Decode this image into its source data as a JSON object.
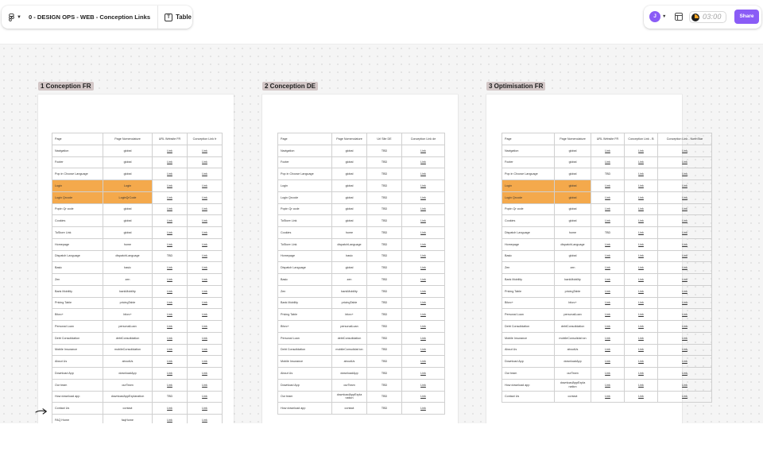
{
  "toolbar": {
    "file_title": "0 - DESIGN OPS - WEB - Conception Links",
    "view_icon": "table-view-icon",
    "view_label": "Table",
    "avatar_initial": "J",
    "timer": "03:00",
    "share_label": "Share",
    "accent_color": "#8a5cf6"
  },
  "frames": [
    {
      "label": "1 Conception FR",
      "columns": [
        {
          "header": "Page",
          "w": 64
        },
        {
          "header": "Page Nomenclature",
          "w": 62
        },
        {
          "header": "URL Website FR",
          "w": 44
        },
        {
          "header": "Conception Link fr",
          "w": 44
        }
      ],
      "rows": [
        [
          "Navigation",
          "global",
          "Link",
          "Link"
        ],
        [
          "Footer",
          "global",
          "Link",
          "Link"
        ],
        [
          "Pop in Choose Language",
          "global",
          "Link",
          "Link"
        ],
        [
          "Login",
          "Login",
          "Link",
          "Link"
        ],
        [
          "Login Qrcode",
          "LoginQrCode",
          "Link",
          "Link"
        ],
        [
          "Popin Qr code",
          "global",
          "Link",
          "Link"
        ],
        [
          "Cookies",
          "global",
          "Link",
          "Link"
        ],
        [
          "ToStore Link",
          "global",
          "Link",
          "Link"
        ],
        [
          "Homepage",
          "home",
          "Link",
          "Link"
        ],
        [
          "Dispatch Language",
          "dispatchLanguage",
          "TBD",
          "Link"
        ],
        [
          "Basic",
          "basic",
          "Link",
          "Link"
        ],
        [
          "Zen",
          "zen",
          "Link",
          "Link"
        ],
        [
          "Bank Mobility",
          "bankMobility",
          "Link",
          "Link"
        ],
        [
          "Pricing Table",
          "pricingTable",
          "Link",
          "Link"
        ],
        [
          "Bforc+",
          "bforc+",
          "Link",
          "Link"
        ],
        [
          "Personal Loan",
          "personalLoan",
          "Link",
          "Link"
        ],
        [
          "Debt Consolidation",
          "debtConsolidation",
          "Link",
          "Link"
        ],
        [
          "Mobile Insurance",
          "mobileConsolidation",
          "Link",
          "Link"
        ],
        [
          "About Us",
          "aboutUs",
          "Link",
          "Link"
        ],
        [
          "Download App",
          "downloadApp",
          "Link",
          "Link"
        ],
        [
          "Our team",
          "ourTeam",
          "Link",
          "Link"
        ],
        [
          "How download app",
          "downloadAppExplanation",
          "TBD",
          "Link"
        ],
        [
          "Contact Us",
          "contact",
          "Link",
          "Link"
        ],
        [
          "FAQ Home",
          "faqHome",
          "Link",
          "Link"
        ]
      ],
      "highlighted_rows": [
        3,
        4
      ]
    },
    {
      "label": "2 Conception DE",
      "columns": [
        {
          "header": "Page",
          "w": 68
        },
        {
          "header": "Page Nomenclature",
          "w": 44
        },
        {
          "header": "Url Site DE",
          "w": 44
        },
        {
          "header": "Conception Link de",
          "w": 54
        }
      ],
      "rows": [
        [
          "Navigation",
          "global",
          "TBD",
          "Link"
        ],
        [
          "Footer",
          "global",
          "TBD",
          "Link"
        ],
        [
          "Pop in Choose Language",
          "global",
          "TBD",
          "Link"
        ],
        [
          "Login",
          "global",
          "TBD",
          "Link"
        ],
        [
          "Login Qrcode",
          "global",
          "TBD",
          "Link"
        ],
        [
          "Popin Qr code",
          "global",
          "TBD",
          "Link"
        ],
        [
          "ToStore Link",
          "global",
          "TBD",
          "Link"
        ],
        [
          "Cookies",
          "home",
          "TBD",
          "Link"
        ],
        [
          "ToStore Link",
          "dispatchLanguage",
          "TBD",
          "Link"
        ],
        [
          "Homepage",
          "basic",
          "TBD",
          "Link"
        ],
        [
          "Dispatch Language",
          "global",
          "TBD",
          "Link"
        ],
        [
          "Basic",
          "zen",
          "TBD",
          "Link"
        ],
        [
          "Zen",
          "bankMobility",
          "TBD",
          "Link"
        ],
        [
          "Bank Mobility",
          "pricingTable",
          "TBD",
          "Link"
        ],
        [
          "Pricing Table",
          "bforc+",
          "TBD",
          "Link"
        ],
        [
          "Bforc+",
          "personalLoan",
          "TBD",
          "Link"
        ],
        [
          "Personal Loan",
          "debtConsolidation",
          "TBD",
          "Link"
        ],
        [
          "Debt Consolidation",
          "mobileConsolidat ion",
          "TBD",
          "Link"
        ],
        [
          "Mobile Insurance",
          "aboutUs",
          "TBD",
          "Link"
        ],
        [
          "About Us",
          "downloadApp",
          "TBD",
          "Link"
        ],
        [
          "Download App",
          "ourTeam",
          "TBD",
          "Link"
        ],
        [
          "Our team",
          "downloadAppExpla nation",
          "TBD",
          "Link"
        ],
        [
          "How download app",
          "contact",
          "TBD",
          "Link"
        ]
      ],
      "highlighted_rows": []
    },
    {
      "label": "3 Optimisation FR",
      "columns": [
        {
          "header": "Page",
          "w": 66
        },
        {
          "header": "Page Nomenclature",
          "w": 46
        },
        {
          "header": "URL Website FR",
          "w": 42
        },
        {
          "header": "Conception Link - B",
          "w": 42
        },
        {
          "header": "Conception Link - NorthStar",
          "w": 68
        }
      ],
      "rows": [
        [
          "Navigation",
          "global",
          "Link",
          "Link",
          "Link"
        ],
        [
          "Footer",
          "global",
          "Link",
          "Link",
          "Link"
        ],
        [
          "Pop in Choose Language",
          "global",
          "TBD",
          "Link",
          "Link"
        ],
        [
          "Login",
          "global",
          "Link",
          "Link",
          "Link"
        ],
        [
          "Login Qrcode",
          "global",
          "Link",
          "Link",
          "Link"
        ],
        [
          "Popin Qr code",
          "global",
          "Link",
          "Link",
          "Link"
        ],
        [
          "Cookies",
          "global",
          "Link",
          "Link",
          "Link"
        ],
        [
          "Dispatch Language",
          "home",
          "TBD",
          "Link",
          "Link"
        ],
        [
          "Homepage",
          "dispatchLanguage",
          "Link",
          "Link",
          "Link"
        ],
        [
          "Basic",
          "global",
          "Link",
          "Link",
          "Link"
        ],
        [
          "Zen",
          "zen",
          "Link",
          "Link",
          "Link"
        ],
        [
          "Bank Mobility",
          "bankMobility",
          "Link",
          "Link",
          "Link"
        ],
        [
          "Pricing Table",
          "pricingTable",
          "Link",
          "Link",
          "Link"
        ],
        [
          "Bforc+",
          "bforc+",
          "Link",
          "Link",
          "Link"
        ],
        [
          "Personal Loan",
          "personalLoan",
          "Link",
          "Link",
          "Link"
        ],
        [
          "Debt Consolidation",
          "debtConsolidation",
          "Link",
          "Link",
          "Link"
        ],
        [
          "Mobile Insurance",
          "mobileConsolidat ion",
          "Link",
          "Link",
          "Link"
        ],
        [
          "About Us",
          "aboutUs",
          "Link",
          "Link",
          "Link"
        ],
        [
          "Download App",
          "downloadApp",
          "Link",
          "Link",
          "Link"
        ],
        [
          "Our team",
          "ourTeam",
          "Link",
          "Link",
          "Link"
        ],
        [
          "How download app",
          "downloadAppExpla nation",
          "Link",
          "Link",
          "Link"
        ],
        [
          "Contact Us",
          "contact",
          "Link",
          "Link",
          "Link"
        ]
      ],
      "highlighted_rows": [
        3,
        4
      ]
    }
  ],
  "highlight_color": "#f4a94c",
  "cursor_icon": "arrow-cursor-icon"
}
